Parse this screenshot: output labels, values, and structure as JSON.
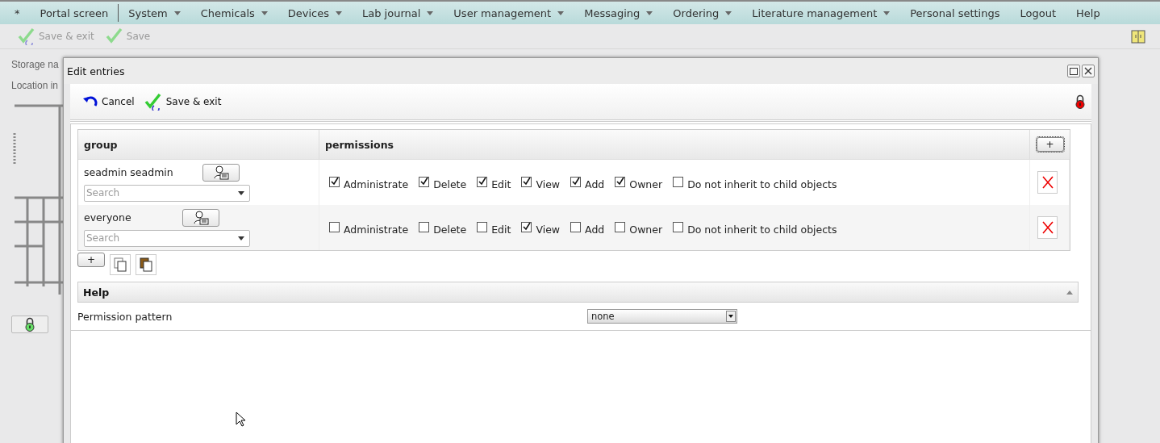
{
  "menu": [
    {
      "label": "*",
      "dropdown": false,
      "separator_after": false
    },
    {
      "label": "Portal screen",
      "dropdown": false,
      "separator_after": true
    },
    {
      "label": "System",
      "dropdown": true,
      "separator_after": false
    },
    {
      "label": "Chemicals",
      "dropdown": true,
      "separator_after": false
    },
    {
      "label": "Devices",
      "dropdown": true,
      "separator_after": false
    },
    {
      "label": "Lab journal",
      "dropdown": true,
      "separator_after": false
    },
    {
      "label": "User management",
      "dropdown": true,
      "separator_after": false
    },
    {
      "label": "Messaging",
      "dropdown": true,
      "separator_after": false
    },
    {
      "label": "Ordering",
      "dropdown": true,
      "separator_after": false
    },
    {
      "label": "Literature management",
      "dropdown": true,
      "separator_after": false
    },
    {
      "label": "Personal settings",
      "dropdown": false,
      "separator_after": false
    },
    {
      "label": "Logout",
      "dropdown": false,
      "separator_after": false
    },
    {
      "label": "Help",
      "dropdown": false,
      "separator_after": false
    }
  ],
  "toolbar": {
    "buttons": [
      {
        "label": "Save & exit",
        "kind": "save-exit",
        "disabled": true
      },
      {
        "label": "Save",
        "kind": "save",
        "disabled": true
      }
    ]
  },
  "background_form": {
    "storage_label": "Storage na",
    "location_label": "Location in"
  },
  "dialog": {
    "title": "Edit entries",
    "toolbar": [
      {
        "label": "Cancel",
        "kind": "cancel"
      },
      {
        "label": "Save & exit",
        "kind": "save-exit"
      }
    ],
    "locked": true,
    "table": {
      "columns": [
        "group",
        "permissions"
      ],
      "rows": [
        {
          "group": "seadmin seadmin",
          "search_placeholder": "Search",
          "permissions": [
            {
              "label": "Administrate",
              "checked": true
            },
            {
              "label": "Delete",
              "checked": true
            },
            {
              "label": "Edit",
              "checked": true
            },
            {
              "label": "View",
              "checked": true
            },
            {
              "label": "Add",
              "checked": true
            },
            {
              "label": "Owner",
              "checked": true
            },
            {
              "label": "Do not inherit to child objects",
              "checked": false
            }
          ]
        },
        {
          "group": "everyone",
          "search_placeholder": "Search",
          "permissions": [
            {
              "label": "Administrate",
              "checked": false
            },
            {
              "label": "Delete",
              "checked": false
            },
            {
              "label": "Edit",
              "checked": false
            },
            {
              "label": "View",
              "checked": true
            },
            {
              "label": "Add",
              "checked": false
            },
            {
              "label": "Owner",
              "checked": false
            },
            {
              "label": "Do not inherit to child objects",
              "checked": false
            }
          ]
        }
      ]
    },
    "add_button": "+",
    "row_add_button": "+",
    "help": {
      "title": "Help"
    },
    "pattern": {
      "label": "Permission pattern",
      "value": "none"
    }
  }
}
